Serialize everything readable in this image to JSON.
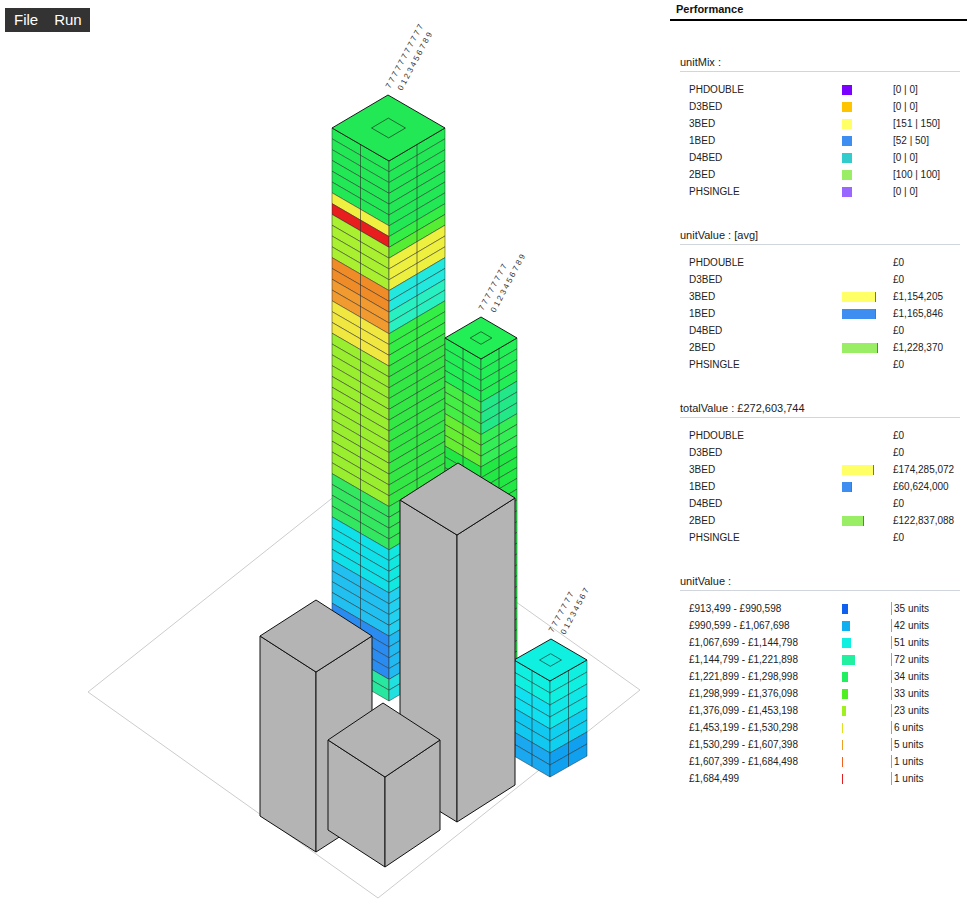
{
  "menu": [
    {
      "label": "File"
    },
    {
      "label": "Run"
    }
  ],
  "canvas": {
    "towers": [
      {
        "labels": [
          "7 7 7 7 7 7 7 7 7 7 7",
          "0 1 2 3 4 5 6 7 8 9"
        ],
        "floorBands": [
          {
            "floors": 6,
            "left": "#22e855",
            "right": "#22e855"
          },
          {
            "floors": 1,
            "left": "#f0f040",
            "right": "#22e855"
          },
          {
            "floors": 1,
            "left": "#e81e1e",
            "right": "#33ee44"
          },
          {
            "floors": 1,
            "left": "#a8f030",
            "right": "#55ee33"
          },
          {
            "floors": 3,
            "left": "#a8f030",
            "right": "#eef040"
          },
          {
            "floors": 2,
            "left": "#f08c28",
            "right": "#22e8dd"
          },
          {
            "floors": 2,
            "left": "#f09a30",
            "right": "#28f0c0"
          },
          {
            "floors": 3,
            "left": "#f0e840",
            "right": "#33ee44"
          },
          {
            "floors": 13,
            "left": "#99ee30",
            "right": "#33e844"
          },
          {
            "floors": 4,
            "left": "#33e860",
            "right": "#33e855"
          },
          {
            "floors": 4,
            "left": "#10e0e8",
            "right": "#10e8e0"
          },
          {
            "floors": 4,
            "left": "#22c0f0",
            "right": "#22d0f0"
          },
          {
            "floors": 4,
            "left": "#2a8cf0",
            "right": "#22b8f0"
          },
          {
            "floors": 2,
            "left": "#28e8a0",
            "right": "#20e0e0"
          }
        ]
      },
      {
        "labels": [
          "7 7 7 7 7 7 7 7",
          "0 1 2 3 4 5 6 7 8 9"
        ],
        "floorBands": [
          {
            "floors": 4,
            "left": "#22ee55",
            "right": "#22ee55"
          },
          {
            "floors": 3,
            "left": "#44ee44",
            "right": "#22e888"
          },
          {
            "floors": 3,
            "left": "#66ee33",
            "right": "#33ee55"
          },
          {
            "floors": 22,
            "left": "#22e844",
            "right": "#22e844"
          }
        ]
      },
      {
        "labels": [
          "7 7 7 7 7 7 7",
          "0 1 2 3 4 5 6 7"
        ],
        "floorBands": [
          {
            "floors": 2,
            "left": "#10f0e0",
            "right": "#10f0e0"
          },
          {
            "floors": 2,
            "left": "#10e0f0",
            "right": "#10e8e8"
          },
          {
            "floors": 2,
            "left": "#10c8f0",
            "right": "#10d0f0"
          },
          {
            "floors": 2,
            "left": "#1aa8f0",
            "right": "#10a0f0"
          }
        ]
      }
    ]
  },
  "panel": {
    "title": "Performance",
    "sections": [
      {
        "title": "unitMix :",
        "kind": "swatch",
        "rows": [
          {
            "label": "PHDOUBLE",
            "value": "[0 | 0]",
            "color": "#7a00ff",
            "level": 1
          },
          {
            "label": "D3BED",
            "value": "[0 | 0]",
            "color": "#ffc400",
            "level": 1
          },
          {
            "label": "3BED",
            "value": "[151 | 150]",
            "color": "#ffff66",
            "level": 1
          },
          {
            "label": "1BED",
            "value": "[52 | 50]",
            "color": "#3d8ef0",
            "level": 1
          },
          {
            "label": "D4BED",
            "value": "[0 | 0]",
            "color": "#33cccc",
            "level": 1
          },
          {
            "label": "2BED",
            "value": "[100 | 100]",
            "color": "#99ee66",
            "level": 1
          },
          {
            "label": "PHSINGLE",
            "value": "[0 | 0]",
            "color": "#9966ff",
            "level": 1
          }
        ]
      },
      {
        "title": "unitValue : [avg]",
        "kind": "bar",
        "rows": [
          {
            "label": "PHDOUBLE",
            "value": "£0",
            "color": "#7a00ff",
            "level": 0
          },
          {
            "label": "D3BED",
            "value": "£0",
            "color": "#ffc400",
            "level": 0
          },
          {
            "label": "3BED",
            "value": "£1,154,205",
            "color": "#ffff66",
            "level": 0.94
          },
          {
            "label": "1BED",
            "value": "£1,165,846",
            "color": "#3d8ef0",
            "level": 0.95
          },
          {
            "label": "D4BED",
            "value": "£0",
            "color": "#33cccc",
            "level": 0
          },
          {
            "label": "2BED",
            "value": "£1,228,370",
            "color": "#99ee66",
            "level": 1
          },
          {
            "label": "PHSINGLE",
            "value": "£0",
            "color": "#9966ff",
            "level": 0
          }
        ]
      },
      {
        "title": "totalValue : £272,603,744",
        "kind": "bar",
        "rows": [
          {
            "label": "PHDOUBLE",
            "value": "£0",
            "color": "#7a00ff",
            "level": 0
          },
          {
            "label": "D3BED",
            "value": "£0",
            "color": "#ffc400",
            "level": 0
          },
          {
            "label": "3BED",
            "value": "£174,285,072",
            "color": "#ffff66",
            "level": 0.89
          },
          {
            "label": "1BED",
            "value": "£60,624,000",
            "color": "#3d8ef0",
            "level": 0.28
          },
          {
            "label": "D4BED",
            "value": "£0",
            "color": "#33cccc",
            "level": 0
          },
          {
            "label": "2BED",
            "value": "£122,837,088",
            "color": "#99ee66",
            "level": 0.61
          },
          {
            "label": "PHSINGLE",
            "value": "£0",
            "color": "#9966ff",
            "level": 0
          }
        ]
      },
      {
        "title": "unitValue :",
        "kind": "histogram",
        "rows": [
          {
            "label": "£913,499 - £990,598",
            "value": "35 units",
            "color": "#1060f0",
            "level": 0.49
          },
          {
            "label": "£990,599 - £1,067,698",
            "value": "42 units",
            "color": "#10b0f0",
            "level": 0.58
          },
          {
            "label": "£1,067,699 - £1,144,798",
            "value": "51 units",
            "color": "#10f0e0",
            "level": 0.71
          },
          {
            "label": "£1,144,799 - £1,221,898",
            "value": "72 units",
            "color": "#20f0a0",
            "level": 1
          },
          {
            "label": "£1,221,899 - £1,298,998",
            "value": "34 units",
            "color": "#20f060",
            "level": 0.47
          },
          {
            "label": "£1,298,999 - £1,376,098",
            "value": "33 units",
            "color": "#50f020",
            "level": 0.46
          },
          {
            "label": "£1,376,099 - £1,453,198",
            "value": "23 units",
            "color": "#a0f020",
            "level": 0.32
          },
          {
            "label": "£1,453,199 - £1,530,298",
            "value": "6 units",
            "color": "#e0e020",
            "level": 0.08
          },
          {
            "label": "£1,530,299 - £1,607,398",
            "value": "5 units",
            "color": "#f0a020",
            "level": 0.07
          },
          {
            "label": "£1,607,399 - £1,684,498",
            "value": "1 units",
            "color": "#f06020",
            "level": 0.02
          },
          {
            "label": "£1,684,499",
            "value": "1 units",
            "color": "#e02020",
            "level": 0.02
          }
        ]
      }
    ]
  }
}
